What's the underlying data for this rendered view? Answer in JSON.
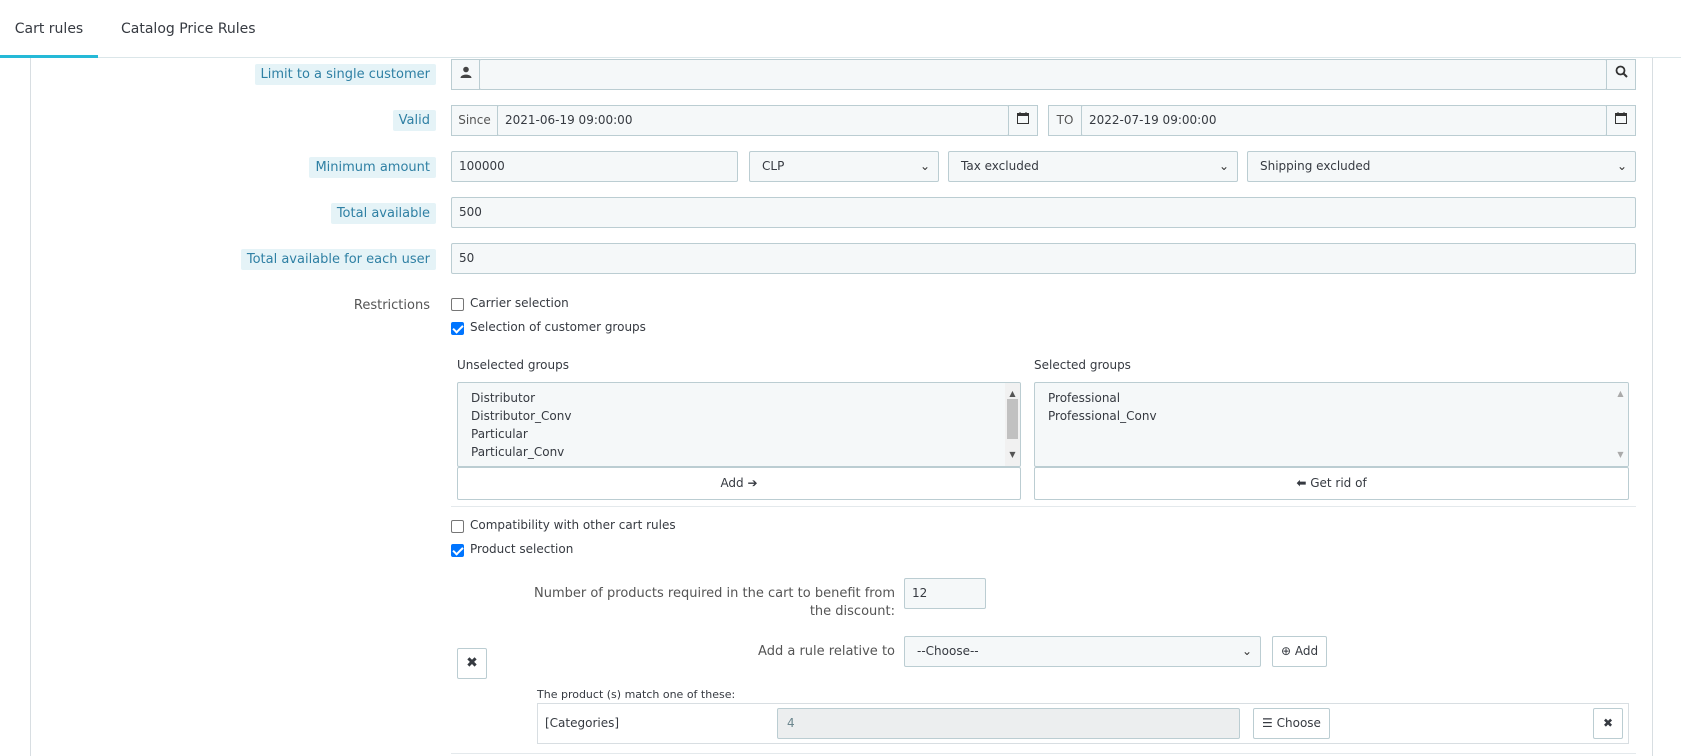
{
  "tabs": [
    {
      "label": "Cart rules",
      "active": true
    },
    {
      "label": "Catalog Price Rules",
      "active": false
    }
  ],
  "form": {
    "single_customer": {
      "label": "Limit to a single customer",
      "value": "",
      "user_icon": "user-icon",
      "search_icon": "search-icon"
    },
    "valid": {
      "label": "Valid",
      "since_label": "Since",
      "since_value": "2021-06-19 09:00:00",
      "to_label": "TO",
      "to_value": "2022-07-19 09:00:00",
      "calendar_icon": "calendar-icon"
    },
    "minimum_amount": {
      "label": "Minimum amount",
      "value": "100000",
      "currency": "CLP",
      "tax": "Tax excluded",
      "shipping": "Shipping excluded"
    },
    "total_available": {
      "label": "Total available",
      "value": "500"
    },
    "total_each_user": {
      "label": "Total available for each user",
      "value": "50"
    },
    "restrictions": {
      "label": "Restrictions",
      "carrier": {
        "label": "Carrier selection",
        "checked": false
      },
      "customer_groups": {
        "label": "Selection of customer groups",
        "checked": true
      },
      "unselected_title": "Unselected groups",
      "unselected": [
        "Distributor",
        "Distributor_Conv",
        "Particular",
        "Particular_Conv"
      ],
      "selected_title": "Selected groups",
      "selected": [
        "Professional",
        "Professional_Conv"
      ],
      "add_button": "Add",
      "remove_button": "Get rid of",
      "compatibility": {
        "label": "Compatibility with other cart rules",
        "checked": false
      },
      "product_selection": {
        "label": "Product selection",
        "checked": true
      },
      "num_products_label_1": "Number of products required in the cart to benefit from",
      "num_products_label_2": "the discount:",
      "num_products_value": "12",
      "add_rule_label": "Add a rule relative to",
      "add_rule_select": "--Choose--",
      "add_rule_button": "Add",
      "match_label": "The product (s) match one of these:",
      "rule_type": "[Categories]",
      "rule_value": "4",
      "choose_button": "Choose"
    }
  },
  "colors": {
    "accent": "#25b9d7",
    "label_highlight": "#e5f3f7",
    "checkbox": "#0075ff"
  }
}
